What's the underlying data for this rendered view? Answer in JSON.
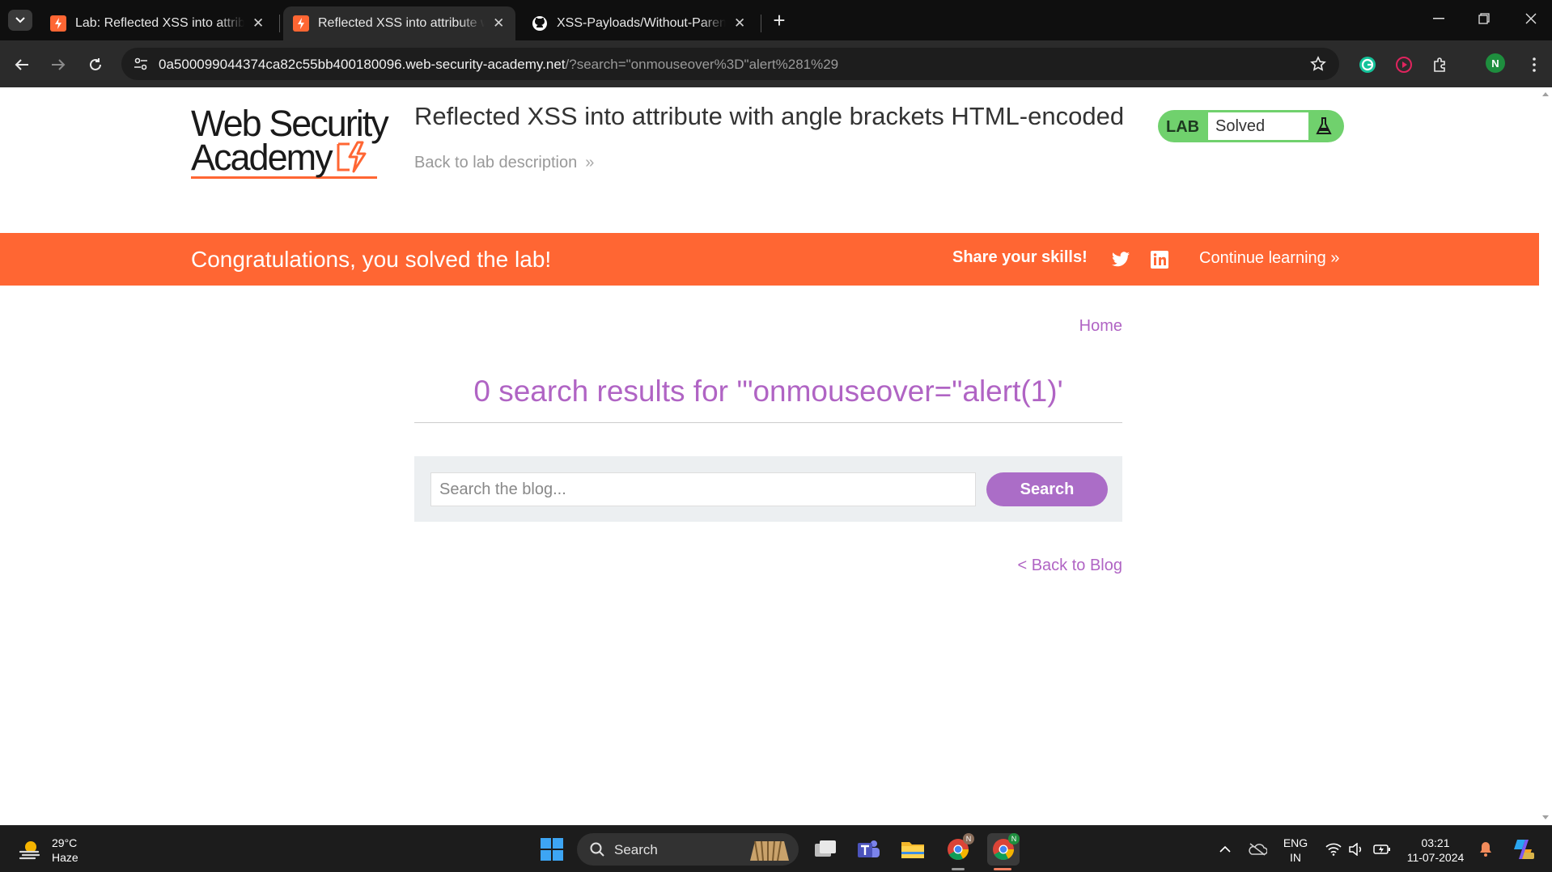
{
  "browser": {
    "tabs": [
      {
        "title": "Lab: Reflected XSS into attribute with angle brackets HTML-encoded",
        "active": false
      },
      {
        "title": "Reflected XSS into attribute with angle brackets HTML-encoded",
        "active": true
      },
      {
        "title": "XSS-Payloads/Without-Parentheses",
        "active": false
      }
    ],
    "url_host": "0a500099044374ca82c55bb400180096.web-security-academy.net",
    "url_path": "/?search=\"onmouseover%3D\"alert%281%29",
    "profile_initial": "N"
  },
  "header": {
    "logo_line1": "Web Security",
    "logo_line2": "Academy",
    "lab_title": "Reflected XSS into attribute with angle brackets HTML-encoded",
    "back_to_description": "Back to lab description",
    "status_label": "LAB",
    "status_value": "Solved"
  },
  "banner": {
    "message": "Congratulations, you solved the lab!",
    "share": "Share your skills!",
    "continue": "Continue learning"
  },
  "main": {
    "home_link": "Home",
    "results_heading": "0 search results for '\"onmouseover=\"alert(1)'",
    "search_placeholder": "Search the blog...",
    "search_button": "Search",
    "back_to_blog": "< Back to Blog"
  },
  "taskbar": {
    "temperature": "29°C",
    "weather": "Haze",
    "search_label": "Search",
    "lang_line1": "ENG",
    "lang_line2": "IN",
    "time": "03:21",
    "date": "11-07-2024"
  },
  "colors": {
    "accent_orange": "#ff6633",
    "link_purple": "#b064c4",
    "solved_green": "#70d16d",
    "button_purple": "#ab6dc7"
  }
}
